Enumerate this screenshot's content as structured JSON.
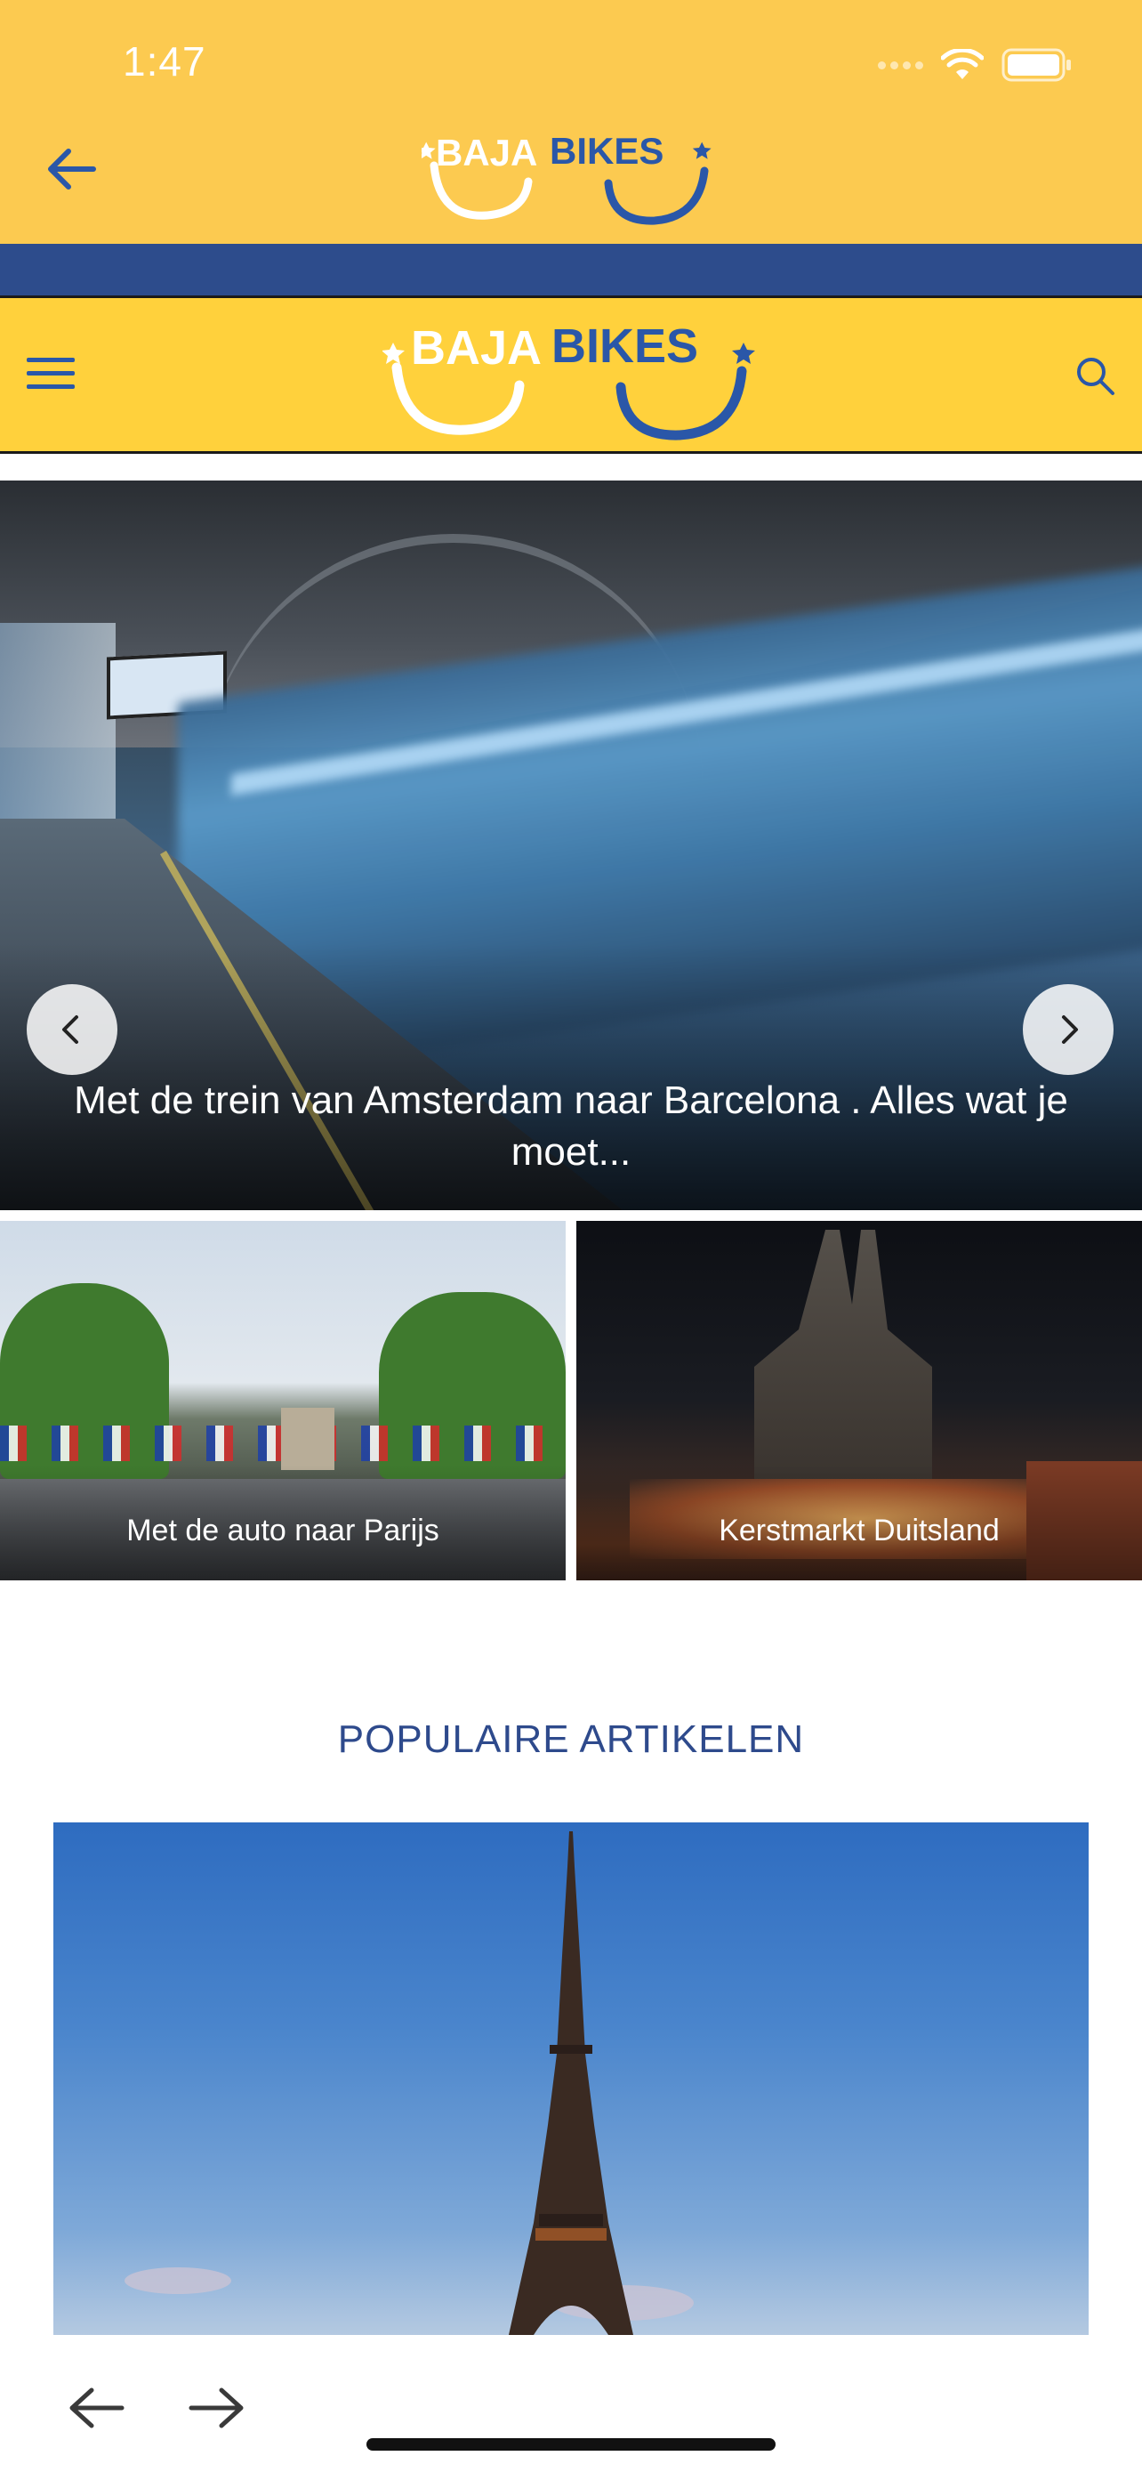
{
  "status_bar": {
    "time": "1:47"
  },
  "app_header": {
    "logo_text_left": "BAJA",
    "logo_text_right": "BIKES"
  },
  "site_header": {
    "logo_text_left": "BAJA",
    "logo_text_right": "BIKES"
  },
  "hero": {
    "caption": "Met de trein van Amsterdam naar Barcelona . Alles wat je moet..."
  },
  "cards": [
    {
      "title": "Met de auto naar Parijs"
    },
    {
      "title": "Kerstmarkt Duitsland"
    }
  ],
  "popular": {
    "title": "POPULAIRE ARTIKELEN"
  },
  "icons": {
    "back": "arrow-left-icon",
    "menu": "hamburger-menu-icon",
    "search": "search-icon",
    "prev": "chevron-left-icon",
    "next": "chevron-right-icon",
    "browser_back": "arrow-left-icon",
    "browser_forward": "arrow-right-icon"
  },
  "colors": {
    "header_yellow": "#FCCA50",
    "site_yellow": "#FFD13C",
    "brand_blue": "#2D4C8C",
    "logo_blue": "#2A57A8",
    "logo_white": "#FFFFFF"
  }
}
